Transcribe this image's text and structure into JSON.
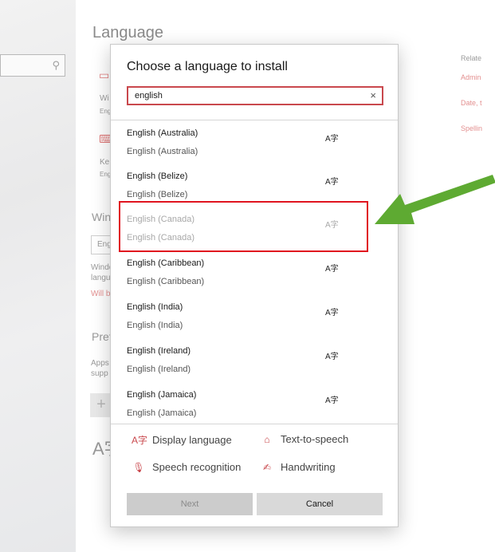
{
  "background": {
    "page_title": "Language",
    "sections": {
      "windows_display": "Win",
      "windows_display_value": "Eng",
      "windows_desc_1": "Windo",
      "windows_desc_2": "langu",
      "windows_link": "Will b",
      "preferred": "Pref",
      "preferred_desc_1": "Apps",
      "preferred_desc_2": "supp",
      "item_1_label": "Wi",
      "item_1_sub": "Eng",
      "item_2_label": "Ke",
      "item_2_sub": "Eng",
      "add_glyph": "+",
      "lang_glyph": "A字"
    },
    "related": {
      "title": "Relate",
      "links": [
        "Admin",
        "Date, t",
        "Spellin"
      ]
    }
  },
  "dialog": {
    "title": "Choose a language to install",
    "search": {
      "value": "english",
      "clear_glyph": "×"
    },
    "feature_glyph": "A字",
    "languages": [
      {
        "name": "English (Australia)",
        "native": "English (Australia)",
        "enabled": true
      },
      {
        "name": "English (Belize)",
        "native": "English (Belize)",
        "enabled": true
      },
      {
        "name": "English (Canada)",
        "native": "English (Canada)",
        "enabled": false
      },
      {
        "name": "English (Caribbean)",
        "native": "English (Caribbean)",
        "enabled": true
      },
      {
        "name": "English (India)",
        "native": "English (India)",
        "enabled": true
      },
      {
        "name": "English (Ireland)",
        "native": "English (Ireland)",
        "enabled": true
      },
      {
        "name": "English (Jamaica)",
        "native": "English (Jamaica)",
        "enabled": true
      }
    ],
    "legend": {
      "display_language": "Display language",
      "text_to_speech": "Text-to-speech",
      "speech_recognition": "Speech recognition",
      "handwriting": "Handwriting"
    },
    "buttons": {
      "next": "Next",
      "cancel": "Cancel"
    }
  },
  "annotation": {
    "highlight_color": "#e0141f",
    "arrow_color": "#5eaa32"
  }
}
